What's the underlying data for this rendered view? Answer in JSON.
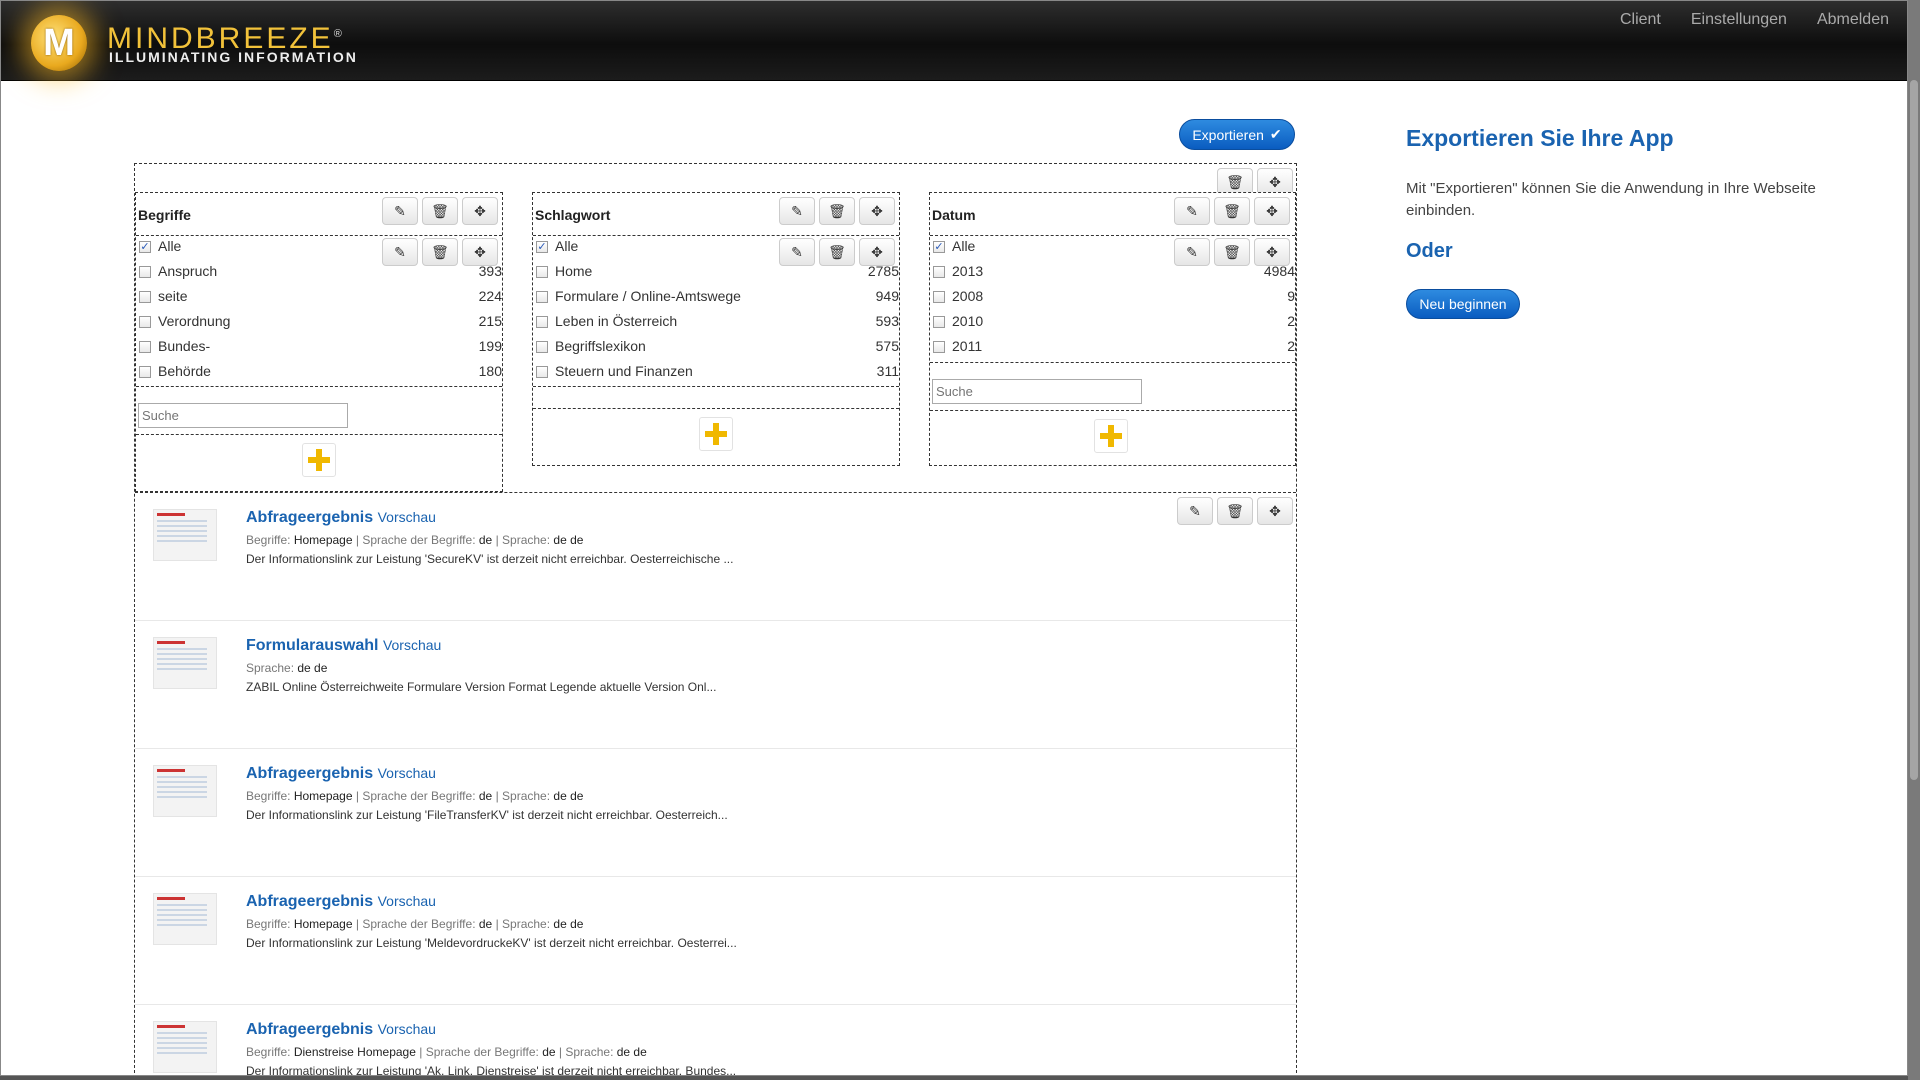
{
  "header": {
    "logo_letter": "M",
    "brand": "MINDBREEZE",
    "registered": "®",
    "tagline": "ILLUMINATING INFORMATION",
    "nav": [
      "Client",
      "Einstellungen",
      "Abmelden"
    ]
  },
  "toolbar": {
    "export_label": "Exportieren",
    "export_check": "✔"
  },
  "icons": {
    "edit": "✎",
    "delete": "🗑",
    "move": "✥"
  },
  "facets": [
    {
      "title": "Begriffe",
      "items": [
        {
          "label": "Alle",
          "count": "",
          "checked": true
        },
        {
          "label": "Anspruch",
          "count": "393",
          "checked": false
        },
        {
          "label": "seite",
          "count": "224",
          "checked": false
        },
        {
          "label": "Verordnung",
          "count": "215",
          "checked": false
        },
        {
          "label": "Bundes-",
          "count": "199",
          "checked": false
        },
        {
          "label": "Behörde",
          "count": "180",
          "checked": false
        }
      ],
      "search_placeholder": "Suche"
    },
    {
      "title": "Schlagwort",
      "items": [
        {
          "label": "Alle",
          "count": "",
          "checked": true
        },
        {
          "label": "Home",
          "count": "2785",
          "checked": false
        },
        {
          "label": "Formulare / Online-Amtswege",
          "count": "949",
          "checked": false
        },
        {
          "label": "Leben in Österreich",
          "count": "593",
          "checked": false
        },
        {
          "label": "Begriffslexikon",
          "count": "575",
          "checked": false
        },
        {
          "label": "Steuern und Finanzen",
          "count": "311",
          "checked": false
        }
      ]
    },
    {
      "title": "Datum",
      "items": [
        {
          "label": "Alle",
          "count": "",
          "checked": true
        },
        {
          "label": "2013",
          "count": "4984",
          "checked": false
        },
        {
          "label": "2008",
          "count": "9",
          "checked": false
        },
        {
          "label": "2010",
          "count": "2",
          "checked": false
        },
        {
          "label": "2011",
          "count": "2",
          "checked": false
        }
      ],
      "search_placeholder": "Suche"
    }
  ],
  "results": [
    {
      "title": "Abfrageergebnis",
      "preview": "Vorschau",
      "meta": [
        {
          "label": "Begriffe:",
          "value": "Homepage"
        },
        {
          "label": "Sprache der Begriffe:",
          "value": "de"
        },
        {
          "label": "Sprache:",
          "value": "de de"
        }
      ],
      "snippet": "Der Informationslink zur Leistung 'SecureKV' ist derzeit nicht erreichbar. Oesterreichische ..."
    },
    {
      "title": "Formularauswahl",
      "preview": "Vorschau",
      "meta": [
        {
          "label": "Sprache:",
          "value": "de de"
        }
      ],
      "snippet": "ZABIL Online Österreichweite Formulare Version Format Legende aktuelle Version Onl..."
    },
    {
      "title": "Abfrageergebnis",
      "preview": "Vorschau",
      "meta": [
        {
          "label": "Begriffe:",
          "value": "Homepage"
        },
        {
          "label": "Sprache der Begriffe:",
          "value": "de"
        },
        {
          "label": "Sprache:",
          "value": "de de"
        }
      ],
      "snippet": "Der Informationslink zur Leistung 'FileTransferKV' ist derzeit nicht erreichbar. Oesterreich..."
    },
    {
      "title": "Abfrageergebnis",
      "preview": "Vorschau",
      "meta": [
        {
          "label": "Begriffe:",
          "value": "Homepage"
        },
        {
          "label": "Sprache der Begriffe:",
          "value": "de"
        },
        {
          "label": "Sprache:",
          "value": "de de"
        }
      ],
      "snippet": "Der Informationslink zur Leistung 'MeldevordruckeKV' ist derzeit nicht erreichbar. Oesterrei..."
    },
    {
      "title": "Abfrageergebnis",
      "preview": "Vorschau",
      "meta": [
        {
          "label": "Begriffe:",
          "value": "Dienstreise Homepage"
        },
        {
          "label": "Sprache der Begriffe:",
          "value": "de"
        },
        {
          "label": "Sprache:",
          "value": "de de"
        }
      ],
      "snippet": "Der Informationslink zur Leistung 'Ak. Link. Dienstreise' ist derzeit nicht erreichbar. Bundes..."
    }
  ],
  "sidebar": {
    "title": "Exportieren Sie Ihre App",
    "description": "Mit \"Exportieren\" können Sie die Anwendung in Ihre Webseite einbinden.",
    "oder": "Oder",
    "new_label": "Neu beginnen"
  },
  "colors": {
    "accent": "#1a63b0",
    "button": "#0a5cc0",
    "plus": "#f0b800"
  }
}
